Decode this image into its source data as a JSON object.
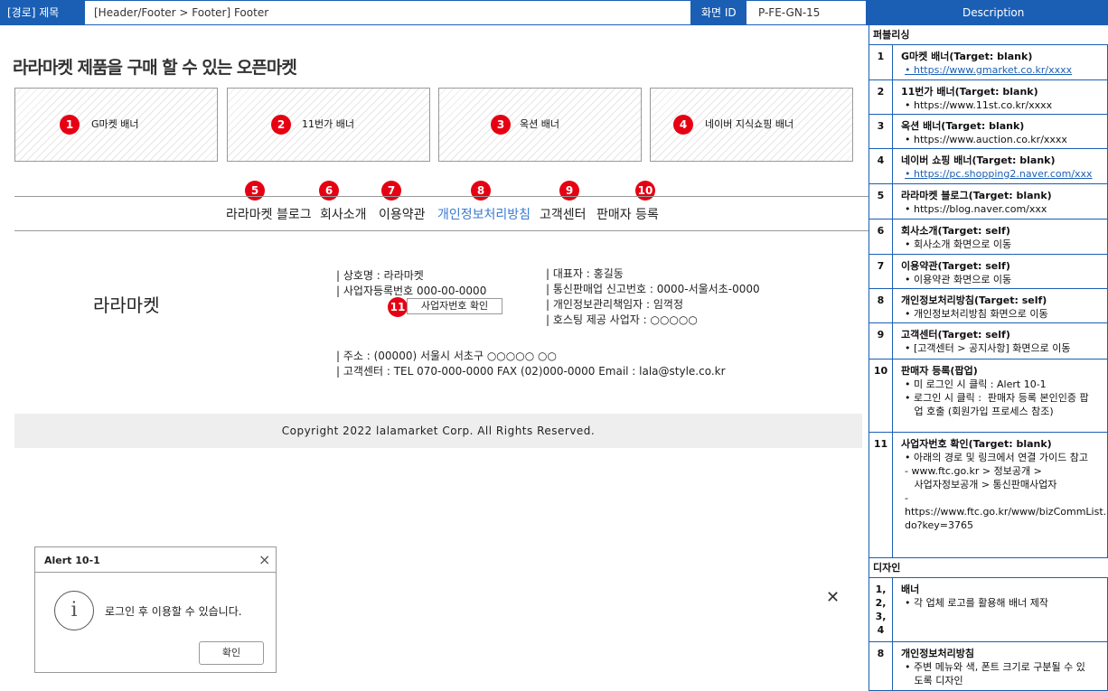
{
  "header": {
    "route_label": "[경로] 제목",
    "route_value": "[Header/Footer > Footer] Footer",
    "screen_id_label": "화면 ID",
    "screen_id_value": "P-FE-GN-15",
    "description_label": "Description"
  },
  "main": {
    "heading": "라라마켓 제품을 구매 할 수 있는 오픈마켓",
    "banners": [
      {
        "badge": "1",
        "label": "G마켓 배너"
      },
      {
        "badge": "2",
        "label": "11번가 배너"
      },
      {
        "badge": "3",
        "label": "옥션 배너"
      },
      {
        "badge": "4",
        "label": "네이버 지식쇼핑 배너"
      }
    ],
    "footer_nav": [
      {
        "badge": "5",
        "label": "라라마켓 블로그"
      },
      {
        "badge": "6",
        "label": "회사소개"
      },
      {
        "badge": "7",
        "label": "이용약관"
      },
      {
        "badge": "8",
        "label": "개인정보처리방침"
      },
      {
        "badge": "9",
        "label": "고객센터"
      },
      {
        "badge": "10",
        "label": "판매자 등록"
      }
    ],
    "logo": "라라마켓",
    "company_info": {
      "col1": [
        "| 상호명 : 라라마켓",
        "| 사업자등록번호 000-00-0000"
      ],
      "col2": [
        "| 대표자 : 홍길동",
        "| 통신판매업 신고번호 : 0000-서울서초-0000",
        "| 개인정보관리책임자 : 임꺽정",
        "| 호스팅 제공 사업자 : ○○○○○"
      ],
      "address": "| 주소 : (00000) 서울시 서초구 ○○○○○ ○○",
      "contact": "| 고객센터 : TEL 070-000-0000 FAX (02)000-0000 Email : lala@style.co.kr"
    },
    "biz_check_badge": "11",
    "biz_check_button": "사업자번호 확인",
    "copyright": "Copyright 2022 lalamarket Corp. All Rights Reserved.",
    "alert": {
      "title": "Alert 10-1",
      "message": "로그인 후 이용할 수 있습니다.",
      "ok_label": "확인",
      "info_glyph": "i",
      "close_glyph": "×"
    },
    "close_glyph": "✕"
  },
  "description": {
    "section_publishing": "퍼블리싱",
    "section_design": "디자인",
    "items": [
      {
        "num": "1",
        "title": "G마켓 배너(Target: blank)",
        "lines": [
          "• https://www.gmarket.co.kr/xxxx"
        ]
      },
      {
        "num": "2",
        "title": "11번가 배너(Target: blank)",
        "lines": [
          "• https://www.11st.co.kr/xxxx"
        ]
      },
      {
        "num": "3",
        "title": "옥션 배너(Target: blank)",
        "lines": [
          "• https://www.auction.co.kr/xxxx"
        ]
      },
      {
        "num": "4",
        "title": "네이버 쇼핑 배너(Target: blank)",
        "lines": [
          "• https://pc.shopping2.naver.com/xxx"
        ]
      },
      {
        "num": "5",
        "title": "라라마켓 블로그(Target: blank)",
        "lines": [
          "• https://blog.naver.com/xxx"
        ]
      },
      {
        "num": "6",
        "title": "회사소개(Target: self)",
        "lines": [
          "• 회사소개 화면으로 이동"
        ]
      },
      {
        "num": "7",
        "title": "이용약관(Target: self)",
        "lines": [
          "• 이용약관 화면으로 이동"
        ]
      },
      {
        "num": "8",
        "title": "개인정보처리방침(Target: self)",
        "lines": [
          "• 개인정보처리방침 화면으로 이동"
        ]
      },
      {
        "num": "9",
        "title": "고객센터(Target: self)",
        "lines": [
          "• [고객센터 > 공지사항] 화면으로 이동"
        ]
      },
      {
        "num": "10",
        "title": "판매자 등록(팝업)",
        "lines": [
          "• 미 로그인 시 클릭 : Alert 10-1",
          "• 로그인 시 클릭 :  판매자 등록 본인인증 팝",
          "   업 호출 (회원가입 프로세스 참조)"
        ]
      },
      {
        "num": "11",
        "title": "사업자번호 확인(Target: blank)",
        "lines": [
          "• 아래의 경로 및 링크에서 연결 가이드 참고",
          "- www.ftc.go.kr > 정보공개 >",
          "   사업자정보공개 > 통신판매사업자",
          "-",
          "https://www.ftc.go.kr/www/bizCommList.",
          "do?key=3765"
        ]
      }
    ],
    "design_items": [
      {
        "num": "1,\n2,\n3,\n4",
        "title": "배너",
        "lines": [
          "• 각 업체 로고를 활용해 배너 제작"
        ]
      },
      {
        "num": "8",
        "title": "개인정보처리방침",
        "lines": [
          "• 주변 메뉴와 색, 폰트 크기로 구분될 수 있",
          "   도록 디자인"
        ]
      }
    ]
  }
}
